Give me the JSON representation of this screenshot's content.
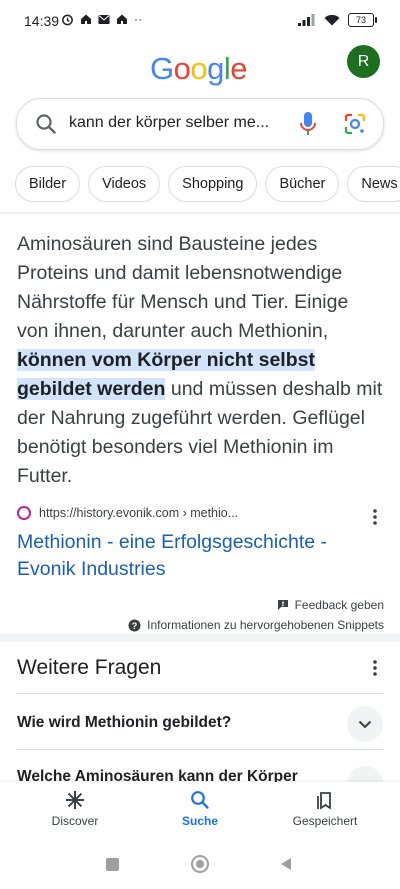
{
  "status_bar": {
    "time": "14:39",
    "battery": "73"
  },
  "header": {
    "logo": [
      "G",
      "o",
      "o",
      "g",
      "l",
      "e"
    ],
    "logo_colors": [
      "#4285F4",
      "#EA4335",
      "#FBBC05",
      "#4285F4",
      "#34A853",
      "#EA4335"
    ],
    "avatar_letter": "R",
    "avatar_color": "#1e6e1f"
  },
  "search": {
    "query": "kann der körper selber me..."
  },
  "chips": [
    "Bilder",
    "Videos",
    "Shopping",
    "Bücher",
    "News"
  ],
  "snippet": {
    "before": "Aminosäuren sind Bausteine jedes Proteins und damit lebensnotwendige Nährstoffe für Mensch und Tier. Einige von ihnen, darunter auch Methionin, ",
    "highlight": "können vom Körper nicht selbst gebildet werden",
    "after": " und müssen deshalb mit der Nahrung zugeführt werden. Geflügel benötigt besonders viel Methionin im Futter."
  },
  "result": {
    "url": "https://history.evonik.com › methio...",
    "title": "Methionin - eine Erfolgsgeschichte - Evonik Industries"
  },
  "feedback": {
    "feedback_label": "Feedback geben",
    "info_label": "Informationen zu hervorgehobenen Snippets"
  },
  "related": {
    "title": "Weitere Fragen",
    "questions": [
      "Wie wird Methionin gebildet?",
      "Welche Aminosäuren kann der Körper"
    ]
  },
  "bottom_nav": [
    {
      "label": "Discover"
    },
    {
      "label": "Suche"
    },
    {
      "label": "Gespeichert"
    }
  ],
  "colors": {
    "accent": "#1a73e8",
    "link": "#1a5fb4",
    "highlight": "#d2e3fc"
  }
}
